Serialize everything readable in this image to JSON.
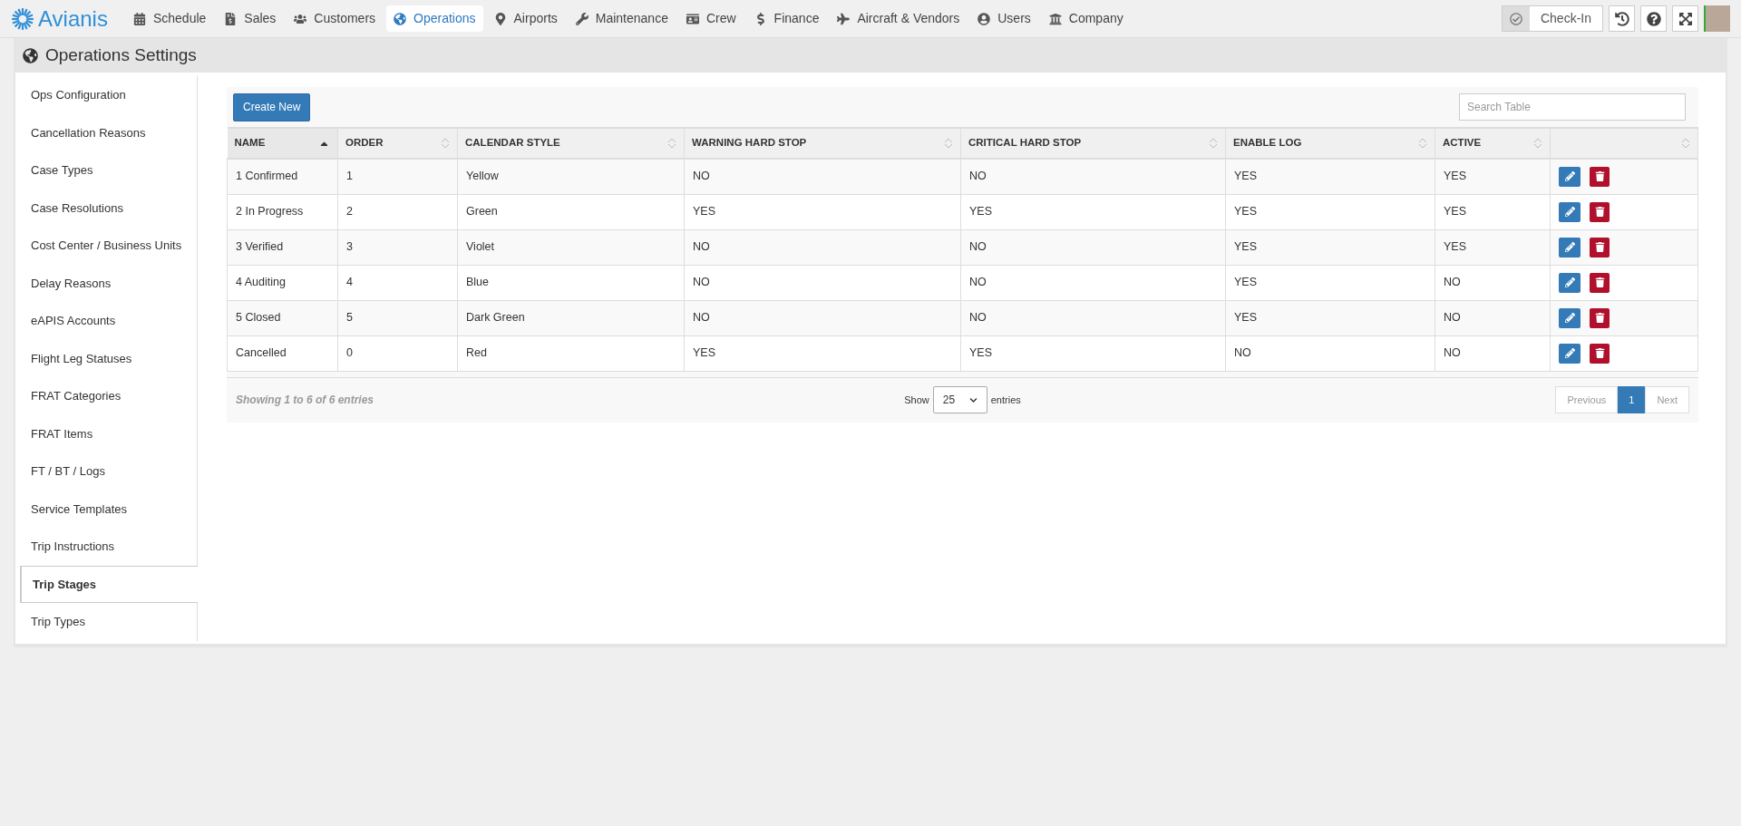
{
  "brand": "Avianis",
  "nav": [
    {
      "label": "Schedule",
      "selected": false
    },
    {
      "label": "Sales",
      "selected": false
    },
    {
      "label": "Customers",
      "selected": false
    },
    {
      "label": "Operations",
      "selected": true
    },
    {
      "label": "Airports",
      "selected": false
    },
    {
      "label": "Maintenance",
      "selected": false
    },
    {
      "label": "Crew",
      "selected": false
    },
    {
      "label": "Finance",
      "selected": false
    },
    {
      "label": "Aircraft & Vendors",
      "selected": false
    },
    {
      "label": "Users",
      "selected": false
    },
    {
      "label": "Company",
      "selected": false
    }
  ],
  "check_in": {
    "label": "Check-In"
  },
  "page_title": "Operations Settings",
  "sidebar": {
    "items": [
      {
        "label": "Ops Configuration",
        "selected": false
      },
      {
        "label": "Cancellation Reasons",
        "selected": false
      },
      {
        "label": "Case Types",
        "selected": false
      },
      {
        "label": "Case Resolutions",
        "selected": false
      },
      {
        "label": "Cost Center / Business Units",
        "selected": false
      },
      {
        "label": "Delay Reasons",
        "selected": false
      },
      {
        "label": "eAPIS Accounts",
        "selected": false
      },
      {
        "label": "Flight Leg Statuses",
        "selected": false
      },
      {
        "label": "FRAT Categories",
        "selected": false
      },
      {
        "label": "FRAT Items",
        "selected": false
      },
      {
        "label": "FT / BT / Logs",
        "selected": false
      },
      {
        "label": "Service Templates",
        "selected": false
      },
      {
        "label": "Trip Instructions",
        "selected": false
      },
      {
        "label": "Trip Stages",
        "selected": true
      },
      {
        "label": "Trip Types",
        "selected": false
      }
    ]
  },
  "create_button": "Create New",
  "search": {
    "placeholder": "Search Table"
  },
  "table": {
    "columns": [
      {
        "label": "NAME",
        "sorted": true
      },
      {
        "label": "ORDER",
        "sorted": false
      },
      {
        "label": "CALENDAR STYLE",
        "sorted": false
      },
      {
        "label": "WARNING HARD STOP",
        "sorted": false
      },
      {
        "label": "CRITICAL HARD STOP",
        "sorted": false
      },
      {
        "label": "ENABLE LOG",
        "sorted": false
      },
      {
        "label": "ACTIVE",
        "sorted": false
      },
      {
        "sorted": false
      }
    ],
    "rows": [
      [
        "1 Confirmed",
        "1",
        "Yellow",
        "NO",
        "NO",
        "YES",
        "YES"
      ],
      [
        "2 In Progress",
        "2",
        "Green",
        "YES",
        "YES",
        "YES",
        "YES"
      ],
      [
        "3 Verified",
        "3",
        "Violet",
        "NO",
        "NO",
        "YES",
        "YES"
      ],
      [
        "4 Auditing",
        "4",
        "Blue",
        "NO",
        "NO",
        "YES",
        "NO"
      ],
      [
        "5 Closed",
        "5",
        "Dark Green",
        "NO",
        "NO",
        "YES",
        "NO"
      ],
      [
        "Cancelled",
        "0",
        "Red",
        "YES",
        "YES",
        "NO",
        "NO"
      ]
    ]
  },
  "footer": {
    "info": "Showing 1 to 6 of 6 entries",
    "show_label": "Show",
    "page_size": "25",
    "entries_label": "entries",
    "pages": [
      {
        "label": "Previous",
        "kind": "prev",
        "disabled": true
      },
      {
        "label": "1",
        "kind": "page",
        "selected": true
      },
      {
        "label": "Next",
        "kind": "next",
        "disabled": true
      }
    ]
  }
}
